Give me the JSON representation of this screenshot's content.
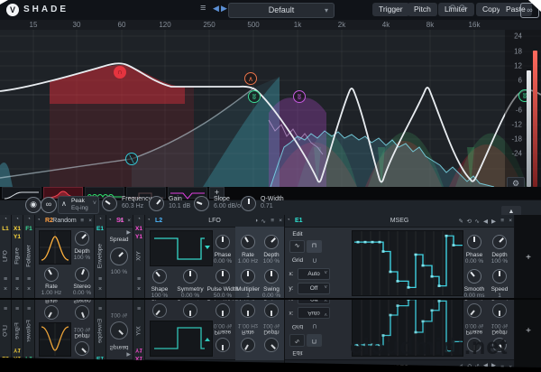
{
  "header": {
    "app_title": "SHADE",
    "preset": {
      "value": "Default"
    },
    "trigger_label": "Trigger",
    "pitch_label": "Pitch",
    "limiter_label": "Limiter",
    "copy_label": "Copy",
    "paste_label": "Paste"
  },
  "freq_scale": {
    "labels": [
      "15",
      "30",
      "60",
      "120",
      "250",
      "500",
      "1k",
      "2k",
      "4k",
      "8k",
      "16k"
    ]
  },
  "db_scale": {
    "labels": [
      "24",
      "18",
      "12",
      "6",
      "-6",
      "-12",
      "-18",
      "-24"
    ]
  },
  "eq": {
    "nodes": [
      {
        "name": "peak-band",
        "glyph": "∩"
      },
      {
        "name": "notch-band",
        "glyph": "∧"
      },
      {
        "name": "comb-band-green",
        "glyph": "ʬ"
      },
      {
        "name": "lowpass-band",
        "glyph": "╲"
      },
      {
        "name": "comb-band-purple",
        "glyph": "ʬ"
      },
      {
        "name": "band-right",
        "glyph": "ʬ"
      }
    ]
  },
  "band_bar": {
    "shape": {
      "line1": "Peak",
      "line2": "Eq-ing"
    },
    "params": [
      {
        "label": "Frequency",
        "value": "60.3 Hz"
      },
      {
        "label": "Gain",
        "value": "10.1 dB"
      },
      {
        "label": "Slope",
        "value": "6.00 dB/o"
      },
      {
        "label": "Q-Width",
        "value": "0.71"
      }
    ]
  },
  "mods": {
    "strips": [
      {
        "code": "L1",
        "code2": "",
        "name": "LFO"
      },
      {
        "code": "X1",
        "code2": "Y1",
        "name": "Figure"
      },
      {
        "code": "F1",
        "code2": "",
        "name": "Follower"
      },
      {
        "code": "E1",
        "code2": "",
        "name": "Envelope"
      },
      {
        "code": "X1",
        "code2": "Y1",
        "name": "X/Y"
      }
    ],
    "random": {
      "code": "R2",
      "title": "Random",
      "depth": {
        "label": "Depth",
        "value": "100 %"
      },
      "rate": {
        "label": "Rate",
        "value": "1.00 Hz"
      },
      "stereo": {
        "label": "Stereo",
        "value": "0.00 %"
      }
    },
    "spread": {
      "code": "S1",
      "label": "Spread",
      "value": "100 %"
    },
    "lfo": {
      "code": "L2",
      "title": "LFO",
      "phase": {
        "label": "Phase",
        "value": "0.00 %"
      },
      "shape": {
        "label": "Shape",
        "value": "100 %"
      },
      "symmetry": {
        "label": "Symmetry",
        "value": "0.00 %"
      },
      "pulse_width": {
        "label": "Pulse Width",
        "value": "50.0 %"
      },
      "rate": {
        "label": "Rate",
        "value": "1.00 Hz"
      },
      "depth": {
        "label": "Depth",
        "value": "100 %"
      },
      "multiplier": {
        "label": "Multiplier",
        "value": "1"
      },
      "swing": {
        "label": "Swing",
        "value": "0.00 %"
      }
    },
    "mseg": {
      "code": "E1",
      "title": "MSEG",
      "edit_label": "Edit",
      "grid_label": "Grid",
      "x_label": "x:",
      "x_value": "Auto",
      "y_label": "y:",
      "y_value": "Off",
      "phase": {
        "label": "Phase",
        "value": "0.00 %"
      },
      "depth": {
        "label": "Depth",
        "value": "100 %"
      },
      "smooth": {
        "label": "Smooth",
        "value": "0.00 ms"
      },
      "speed": {
        "label": "Speed",
        "value": "1"
      }
    }
  },
  "watermark": "cloudmidi.net"
}
